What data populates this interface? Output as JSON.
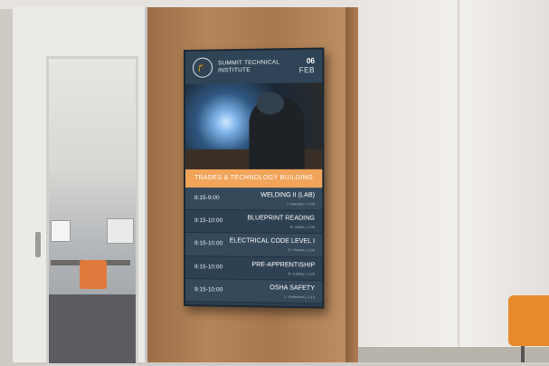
{
  "sign": {
    "institute_name": "SUMMIT TECHNICAL INSTITUTE",
    "date_day": "06",
    "date_month": "FEB",
    "building_banner": "TRADES & TECHNOLOGY BUILDING",
    "schedule": [
      {
        "time": "8:15-9:00",
        "title": "WELDING II (LAB)",
        "room": "J. Harrison | T-04"
      },
      {
        "time": "9:15-10:00",
        "title": "BLUEPRINT READING",
        "room": "B. Gibbs | 1-05"
      },
      {
        "time": "9:15-10:00",
        "title": "ELECTRICAL CODE LEVEL I",
        "room": "D. Hassel | 1-04"
      },
      {
        "time": "9:15-10:00",
        "title": "PRE-APPRENTISHIP",
        "room": "R. Cathey | 1-05"
      },
      {
        "time": "9:15-10:00",
        "title": "OSHA SAFETY",
        "room": "L. Anderson | 1-15"
      }
    ],
    "colors": {
      "panel": "#2c3e4e",
      "banner": "#f1a45a"
    },
    "logo_icon": "graduation-book-icon"
  }
}
